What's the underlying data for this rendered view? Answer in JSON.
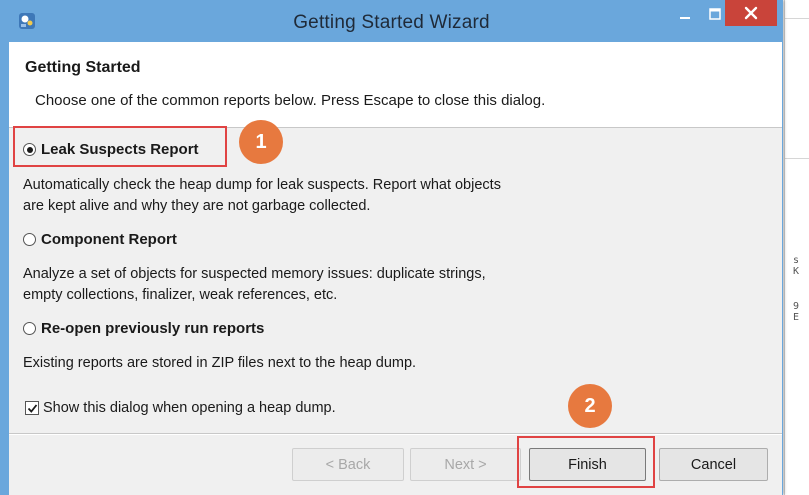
{
  "window": {
    "title": "Getting Started Wizard",
    "accent_color": "#6aa7dc",
    "close_color": "#c9443a"
  },
  "header": {
    "title": "Getting Started",
    "description": "Choose one of the common reports below. Press Escape to close this dialog."
  },
  "options": [
    {
      "label": "Leak Suspects Report",
      "checked": true,
      "description_line1": "Automatically check the heap dump for leak suspects. Report what objects",
      "description_line2": "are kept alive and why they are not garbage collected."
    },
    {
      "label": "Component Report",
      "checked": false,
      "description_line1": "Analyze a set of objects for suspected memory issues: duplicate strings,",
      "description_line2": "empty collections, finalizer, weak references, etc."
    },
    {
      "label": "Re-open previously run reports",
      "checked": false,
      "description_line1": "Existing reports are stored in ZIP files next to the heap dump."
    }
  ],
  "show_dialog_checkbox": {
    "label": "Show this dialog when opening a heap dump.",
    "checked": true
  },
  "buttons": {
    "back": "< Back",
    "next": "Next >",
    "finish": "Finish",
    "cancel": "Cancel"
  },
  "annotations": {
    "step1": "1",
    "step2": "2",
    "highlight_color": "#e04343",
    "badge_color": "#e7793f"
  },
  "icons": {
    "app": "eclipse-mat-icon",
    "minimize": "minimize-icon",
    "maximize": "maximize-icon",
    "close": "close-icon"
  }
}
